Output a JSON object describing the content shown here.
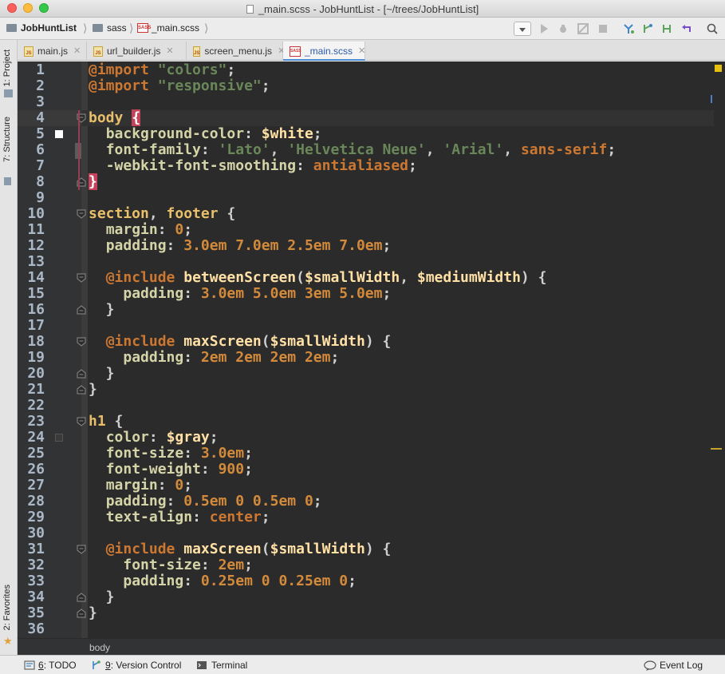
{
  "window": {
    "title": "_main.scss - JobHuntList - [~/trees/JobHuntList]"
  },
  "breadcrumb": {
    "items": [
      "JobHuntList",
      "sass",
      "_main.scss"
    ]
  },
  "tabs": [
    {
      "label": "main.js",
      "active": false
    },
    {
      "label": "url_builder.js",
      "active": false
    },
    {
      "label": "screen_menu.js",
      "active": false
    },
    {
      "label": "_main.scss",
      "active": true
    }
  ],
  "left_strip": {
    "project": "1: Project",
    "structure": "7: Structure",
    "favorites": "2: Favorites"
  },
  "editor": {
    "lines": [
      {
        "n": "1",
        "segs": [
          [
            "kw-at",
            "@import"
          ],
          [
            "p",
            " "
          ],
          [
            "str",
            "\"colors\""
          ],
          [
            "p",
            ";"
          ]
        ]
      },
      {
        "n": "2",
        "segs": [
          [
            "kw-at",
            "@import"
          ],
          [
            "p",
            " "
          ],
          [
            "str",
            "\"responsive\""
          ],
          [
            "p",
            ";"
          ]
        ]
      },
      {
        "n": "3",
        "segs": []
      },
      {
        "n": "4",
        "segs": [
          [
            "tag",
            "body"
          ],
          [
            "p",
            " "
          ],
          [
            "brace-hl",
            "{"
          ]
        ]
      },
      {
        "n": "5",
        "segs": [
          [
            "p",
            "  "
          ],
          [
            "prop",
            "background-color"
          ],
          [
            "p",
            ": "
          ],
          [
            "var",
            "$white"
          ],
          [
            "p",
            ";"
          ]
        ]
      },
      {
        "n": "6",
        "segs": [
          [
            "p",
            "  "
          ],
          [
            "prop",
            "font-family"
          ],
          [
            "p",
            ": "
          ],
          [
            "str",
            "'Lato'"
          ],
          [
            "p",
            ", "
          ],
          [
            "str",
            "'Helvetica Neue'"
          ],
          [
            "p",
            ", "
          ],
          [
            "str",
            "'Arial'"
          ],
          [
            "p",
            ", "
          ],
          [
            "val",
            "sans-serif"
          ],
          [
            "p",
            ";"
          ]
        ]
      },
      {
        "n": "7",
        "segs": [
          [
            "p",
            "  "
          ],
          [
            "prop",
            "-webkit-font-smoothing"
          ],
          [
            "p",
            ": "
          ],
          [
            "val",
            "antialiased"
          ],
          [
            "p",
            ";"
          ]
        ]
      },
      {
        "n": "8",
        "segs": [
          [
            "brace-hl",
            "}"
          ]
        ]
      },
      {
        "n": "9",
        "segs": []
      },
      {
        "n": "10",
        "segs": [
          [
            "tag",
            "section"
          ],
          [
            "p",
            ", "
          ],
          [
            "tag",
            "footer"
          ],
          [
            "p",
            " {"
          ]
        ]
      },
      {
        "n": "11",
        "segs": [
          [
            "p",
            "  "
          ],
          [
            "prop",
            "margin"
          ],
          [
            "p",
            ": "
          ],
          [
            "num",
            "0"
          ],
          [
            "p",
            ";"
          ]
        ]
      },
      {
        "n": "12",
        "segs": [
          [
            "p",
            "  "
          ],
          [
            "prop",
            "padding"
          ],
          [
            "p",
            ": "
          ],
          [
            "num",
            "3.0em 7.0em 2.5em 7.0em"
          ],
          [
            "p",
            ";"
          ]
        ]
      },
      {
        "n": "13",
        "segs": []
      },
      {
        "n": "14",
        "segs": [
          [
            "p",
            "  "
          ],
          [
            "kw-at",
            "@include"
          ],
          [
            "p",
            " "
          ],
          [
            "var",
            "betweenScreen"
          ],
          [
            "p",
            "("
          ],
          [
            "var",
            "$smallWidth"
          ],
          [
            "p",
            ", "
          ],
          [
            "var",
            "$mediumWidth"
          ],
          [
            "p",
            ") {"
          ]
        ]
      },
      {
        "n": "15",
        "segs": [
          [
            "p",
            "    "
          ],
          [
            "prop",
            "padding"
          ],
          [
            "p",
            ": "
          ],
          [
            "num",
            "3.0em 5.0em 3em 5.0em"
          ],
          [
            "p",
            ";"
          ]
        ]
      },
      {
        "n": "16",
        "segs": [
          [
            "p",
            "  }"
          ]
        ]
      },
      {
        "n": "17",
        "segs": []
      },
      {
        "n": "18",
        "segs": [
          [
            "p",
            "  "
          ],
          [
            "kw-at",
            "@include"
          ],
          [
            "p",
            " "
          ],
          [
            "var",
            "maxScreen"
          ],
          [
            "p",
            "("
          ],
          [
            "var",
            "$smallWidth"
          ],
          [
            "p",
            ") {"
          ]
        ]
      },
      {
        "n": "19",
        "segs": [
          [
            "p",
            "    "
          ],
          [
            "prop",
            "padding"
          ],
          [
            "p",
            ": "
          ],
          [
            "num",
            "2em 2em 2em 2em"
          ],
          [
            "p",
            ";"
          ]
        ]
      },
      {
        "n": "20",
        "segs": [
          [
            "p",
            "  }"
          ]
        ]
      },
      {
        "n": "21",
        "segs": [
          [
            "p",
            "}"
          ]
        ]
      },
      {
        "n": "22",
        "segs": []
      },
      {
        "n": "23",
        "segs": [
          [
            "tag",
            "h1"
          ],
          [
            "p",
            " {"
          ]
        ]
      },
      {
        "n": "24",
        "segs": [
          [
            "p",
            "  "
          ],
          [
            "prop",
            "color"
          ],
          [
            "p",
            ": "
          ],
          [
            "var",
            "$gray"
          ],
          [
            "p",
            ";"
          ]
        ]
      },
      {
        "n": "25",
        "segs": [
          [
            "p",
            "  "
          ],
          [
            "prop",
            "font-size"
          ],
          [
            "p",
            ": "
          ],
          [
            "num",
            "3.0em"
          ],
          [
            "p",
            ";"
          ]
        ]
      },
      {
        "n": "26",
        "segs": [
          [
            "p",
            "  "
          ],
          [
            "prop",
            "font-weight"
          ],
          [
            "p",
            ": "
          ],
          [
            "num",
            "900"
          ],
          [
            "p",
            ";"
          ]
        ]
      },
      {
        "n": "27",
        "segs": [
          [
            "p",
            "  "
          ],
          [
            "prop",
            "margin"
          ],
          [
            "p",
            ": "
          ],
          [
            "num",
            "0"
          ],
          [
            "p",
            ";"
          ]
        ]
      },
      {
        "n": "28",
        "segs": [
          [
            "p",
            "  "
          ],
          [
            "prop",
            "padding"
          ],
          [
            "p",
            ": "
          ],
          [
            "num",
            "0.5em 0 0.5em 0"
          ],
          [
            "p",
            ";"
          ]
        ]
      },
      {
        "n": "29",
        "segs": [
          [
            "p",
            "  "
          ],
          [
            "prop",
            "text-align"
          ],
          [
            "p",
            ": "
          ],
          [
            "val",
            "center"
          ],
          [
            "p",
            ";"
          ]
        ]
      },
      {
        "n": "30",
        "segs": []
      },
      {
        "n": "31",
        "segs": [
          [
            "p",
            "  "
          ],
          [
            "kw-at",
            "@include"
          ],
          [
            "p",
            " "
          ],
          [
            "var",
            "maxScreen"
          ],
          [
            "p",
            "("
          ],
          [
            "var",
            "$smallWidth"
          ],
          [
            "p",
            ") {"
          ]
        ]
      },
      {
        "n": "32",
        "segs": [
          [
            "p",
            "    "
          ],
          [
            "prop",
            "font-size"
          ],
          [
            "p",
            ": "
          ],
          [
            "num",
            "2em"
          ],
          [
            "p",
            ";"
          ]
        ]
      },
      {
        "n": "33",
        "segs": [
          [
            "p",
            "    "
          ],
          [
            "prop",
            "padding"
          ],
          [
            "p",
            ": "
          ],
          [
            "num",
            "0.25em 0 0.25em 0"
          ],
          [
            "p",
            ";"
          ]
        ]
      },
      {
        "n": "34",
        "segs": [
          [
            "p",
            "  }"
          ]
        ]
      },
      {
        "n": "35",
        "segs": [
          [
            "p",
            "}"
          ]
        ]
      },
      {
        "n": "36",
        "segs": []
      }
    ],
    "fold_open_lines": [
      "4",
      "10",
      "14",
      "18",
      "23",
      "31"
    ],
    "fold_close_lines": [
      "8",
      "16",
      "20",
      "21",
      "34",
      "35"
    ]
  },
  "editor_breadcrumb": "body",
  "status_bar": {
    "todo": {
      "num": "6",
      "label": ": TODO"
    },
    "vcs": {
      "num": "9",
      "label": ": Version Control"
    },
    "terminal": "Terminal",
    "event_log": "Event Log"
  },
  "colors": {
    "editor_bg": "#2b2b2b",
    "gutter_bg": "#313335",
    "accent": "#4c8fd6"
  }
}
